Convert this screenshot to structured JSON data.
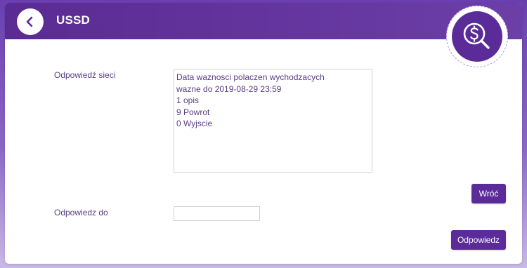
{
  "header": {
    "title": "USSD",
    "back_icon": "chevron-left-icon",
    "badge_icon": "dollar-search-icon"
  },
  "form": {
    "network_response_label": "Odpowiedź sieci",
    "network_response_lines": [
      "Data waznosci polaczen wychodzacych",
      "wazne do 2019-08-29 23:59",
      "1 opis",
      "9 Powrot",
      "0 Wyjscie"
    ],
    "back_button_label": "Wróć",
    "reply_to_label": "Odpowiedz do",
    "reply_input_value": "",
    "reply_button_label": "Odpowiedz"
  },
  "colors": {
    "accent": "#5b2c99",
    "text": "#5a3d84"
  }
}
